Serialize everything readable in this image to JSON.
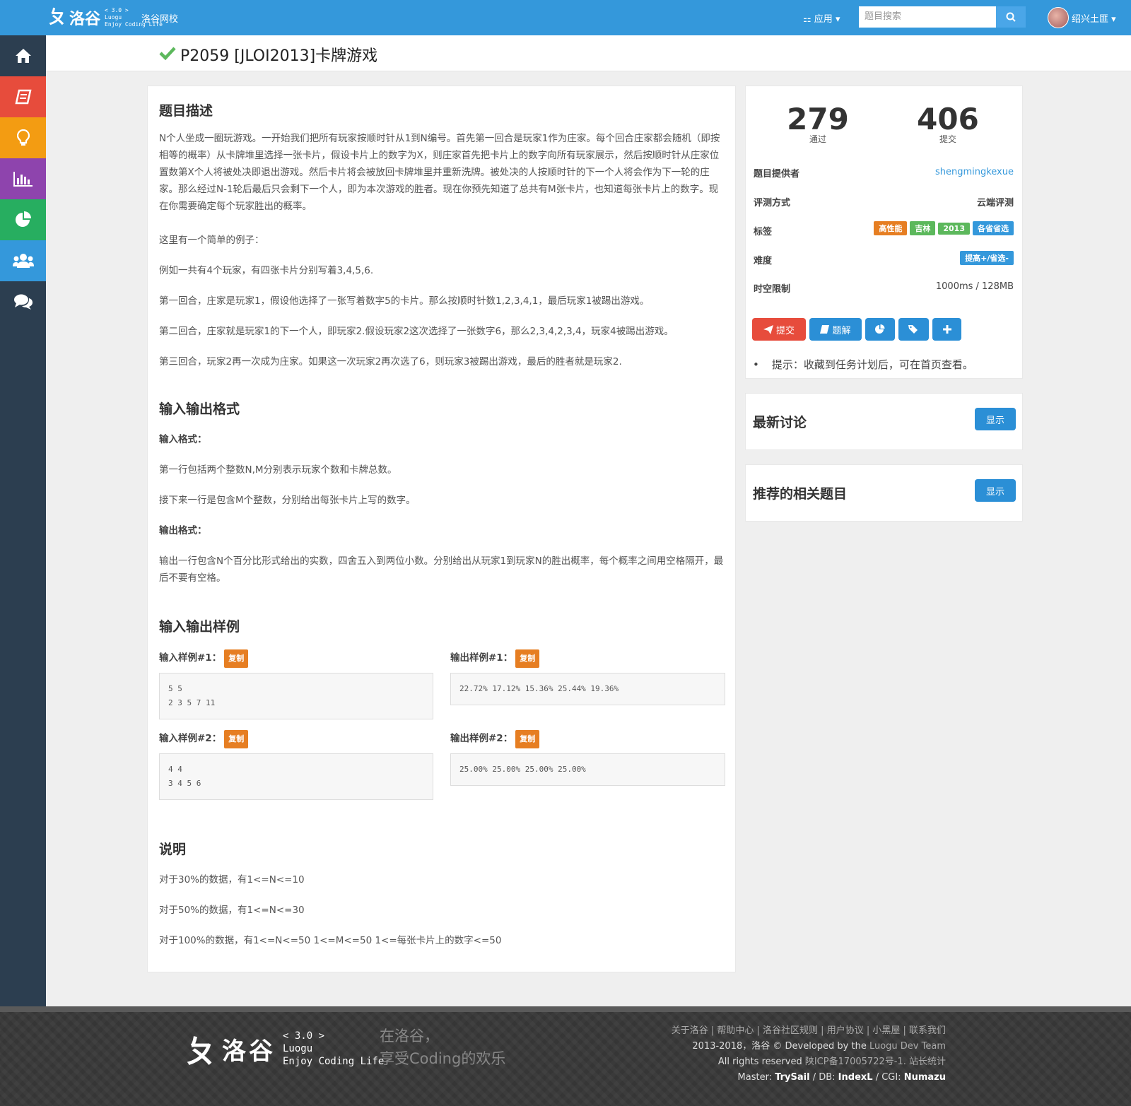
{
  "topbar": {
    "logo_text": "洛谷",
    "logo_version": "< 3.0 >",
    "logo_brand": "Luogu",
    "logo_slogan": "Enjoy Coding Life",
    "nav_link": "洛谷网校",
    "apps_label": "应用",
    "search_placeholder": "题目搜索",
    "username": "绍兴土匪"
  },
  "problem": {
    "title": "P2059 [JLOI2013]卡牌游戏",
    "desc_heading": "题目描述",
    "desc": "N个人坐成一圈玩游戏。一开始我们把所有玩家按顺时针从1到N编号。首先第一回合是玩家1作为庄家。每个回合庄家都会随机（即按相等的概率）从卡牌堆里选择一张卡片，假设卡片上的数字为X，则庄家首先把卡片上的数字向所有玩家展示，然后按顺时针从庄家位置数第X个人将被处决即退出游戏。然后卡片将会被放回卡牌堆里并重新洗牌。被处决的人按顺时针的下一个人将会作为下一轮的庄家。那么经过N-1轮后最后只会剩下一个人，即为本次游戏的胜者。现在你预先知道了总共有M张卡片，也知道每张卡片上的数字。现在你需要确定每个玩家胜出的概率。",
    "example_intro": "这里有一个简单的例子：",
    "example_1": "例如一共有4个玩家，有四张卡片分别写着3,4,5,6.",
    "example_2": "第一回合，庄家是玩家1，假设他选择了一张写着数字5的卡片。那么按顺时针数1,2,3,4,1，最后玩家1被踢出游戏。",
    "example_3": "第二回合，庄家就是玩家1的下一个人，即玩家2.假设玩家2这次选择了一张数字6，那么2,3,4,2,3,4，玩家4被踢出游戏。",
    "example_4": "第三回合，玩家2再一次成为庄家。如果这一次玩家2再次选了6，则玩家3被踢出游戏，最后的胜者就是玩家2.",
    "io_heading": "输入输出格式",
    "input_label": "输入格式：",
    "input_1": "第一行包括两个整数N,M分别表示玩家个数和卡牌总数。",
    "input_2": "接下来一行是包含M个整数，分别给出每张卡片上写的数字。",
    "output_label": "输出格式：",
    "output_1": "输出一行包含N个百分比形式给出的实数，四舍五入到两位小数。分别给出从玩家1到玩家N的胜出概率，每个概率之间用空格隔开，最后不要有空格。",
    "sample_heading": "输入输出样例",
    "copy_label": "复制",
    "sample_in1_label": "输入样例#1：",
    "sample_in1": "5 5\n2 3 5 7 11",
    "sample_out1_label": "输出样例#1：",
    "sample_out1": "22.72% 17.12% 15.36% 25.44% 19.36%",
    "sample_in2_label": "输入样例#2：",
    "sample_in2": "4 4\n3 4 5 6",
    "sample_out2_label": "输出样例#2：",
    "sample_out2": "25.00% 25.00% 25.00% 25.00%",
    "note_heading": "说明",
    "note_1": "对于30%的数据，有1<=N<=10",
    "note_2": "对于50%的数据，有1<=N<=30",
    "note_3": "对于100%的数据，有1<=N<=50 1<=M<=50 1<=每张卡片上的数字<=50"
  },
  "info": {
    "passed": "279",
    "passed_label": "通过",
    "submitted": "406",
    "submitted_label": "提交",
    "provider_label": "题目提供者",
    "provider": "shengmingkexue",
    "judge_label": "评测方式",
    "judge": "云端评测",
    "tags_label": "标签",
    "tags": [
      "高性能",
      "吉林",
      "2013",
      "各省省选"
    ],
    "difficulty_label": "难度",
    "difficulty": "提高+/省选-",
    "limit_label": "时空限制",
    "limit": "1000ms / 128MB",
    "btn_submit": "提交",
    "btn_solution": "题解",
    "tip": "提示：收藏到任务计划后，可在首页查看。"
  },
  "cards": {
    "discuss_title": "最新讨论",
    "related_title": "推荐的相关题目",
    "show_label": "显示"
  },
  "footer": {
    "logo_text": "洛谷",
    "logo_version": "< 3.0 >",
    "logo_brand": "Luogu",
    "logo_slogan": "Enjoy Coding Life",
    "slogan_1": "在洛谷，",
    "slogan_2": "享受Coding的欢乐",
    "links": "关于洛谷 | 帮助中心 | 洛谷社区规则 | 用户协议 | 小黑屋 | 联系我们",
    "copyright_prefix": "2013-2018，洛谷 © Developed by the ",
    "team": "Luogu Dev Team",
    "rights": "All rights reserved ",
    "icp": "陕ICP备17005722号-1. 站长统计",
    "master_prefix": "Master: ",
    "master": "TrySail",
    "db_prefix": " / DB: ",
    "db": "IndexL",
    "cgi_prefix": " / CGI: ",
    "cgi": "Numazu"
  },
  "colors": {
    "brand": "#3498db",
    "sidebar": "#2c3e50",
    "home": "#2c3e50",
    "book": "#e74c3c",
    "bulb": "#f39c12",
    "chart": "#8e44ad",
    "pie": "#27ae60",
    "users": "#3498db",
    "chat": "#2c3e50",
    "tag_orange": "#e67e22",
    "tag_green": "#5cb85c",
    "tag_blue": "#3498db"
  }
}
